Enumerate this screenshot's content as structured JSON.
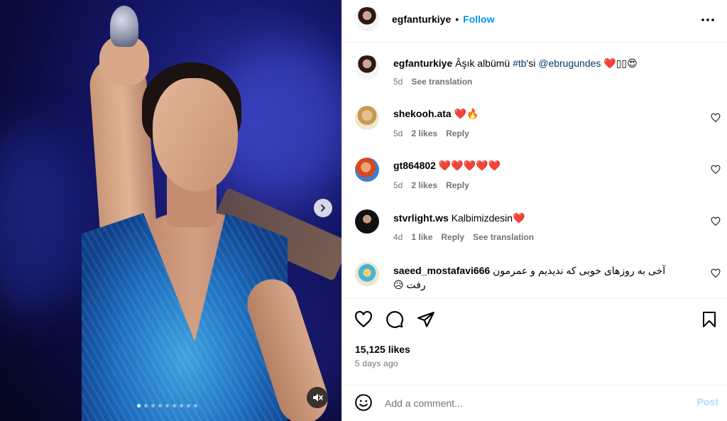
{
  "post": {
    "owner_username": "egfanturkiye",
    "follow_label": "Follow",
    "separator": "•",
    "caption": {
      "username": "egfanturkiye",
      "text_before": "Âşık albümü ",
      "hashtag": "#tb",
      "text_mid": "'si ",
      "mention": "@ebrugundes",
      "emoji": "❤️▯▯😍",
      "time": "5d",
      "see_translation": "See translation"
    },
    "comments": [
      {
        "username": "shekooh.ata",
        "text": "❤️🔥",
        "time": "5d",
        "likes": "2 likes",
        "reply": "Reply"
      },
      {
        "username": "gt864802",
        "text": "❤️❤️❤️❤️❤️",
        "time": "5d",
        "likes": "2 likes",
        "reply": "Reply"
      },
      {
        "username": "stvrlight.ws",
        "text": "Kalbimizdesin❤️",
        "time": "4d",
        "likes": "1 like",
        "reply": "Reply",
        "see_translation": "See translation"
      },
      {
        "username": "saeed_mostafavi666",
        "text": "آخی به روزهای خوبی که ندیدیم و عمرمون رفت 😥"
      }
    ],
    "likes_count": "15,125 likes",
    "posted_ago": "5 days ago",
    "comment_placeholder": "Add a comment...",
    "post_label": "Post",
    "carousel": {
      "total": 9,
      "active_index": 0
    }
  },
  "icons": {
    "more": "more-options-icon",
    "heart": "heart-icon",
    "comment": "comment-icon",
    "share": "share-icon",
    "save": "bookmark-icon",
    "emoji": "emoji-icon",
    "next": "chevron-right-icon",
    "mute": "speaker-muted-icon"
  },
  "colors": {
    "accent": "#0095f6",
    "link": "#00376b",
    "muted": "#737373",
    "post_disabled": "#b3dbff",
    "heart_red": "#ed1c24"
  }
}
